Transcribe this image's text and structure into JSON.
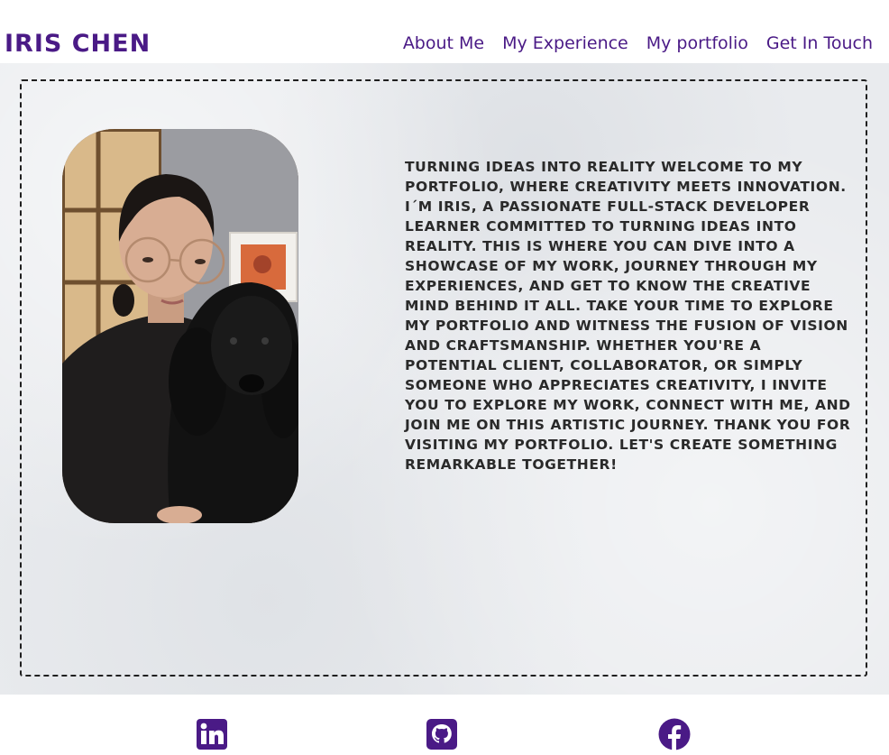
{
  "header": {
    "brand": "IRIS CHEN",
    "nav": [
      {
        "label": "About Me"
      },
      {
        "label": "My Experience"
      },
      {
        "label": "My portfolio"
      },
      {
        "label": "Get In Touch"
      }
    ]
  },
  "about": {
    "bio": "Turning ideas into reality Welcome to my portfolio, where creativity meets innovation. I´m Iris, a passionate full-stack developer learner committed to turning ideas into reality. This is where you can dive into a showcase of my work, journey through my experiences, and get to know the creative mind behind it all. Take your time to explore my portfolio and witness the fusion of vision and craftsmanship. Whether you're a potential client, collaborator, or simply someone who appreciates creativity, I invite you to explore my work, connect with me, and join me on this artistic journey. Thank you for visiting my portfolio. Let's create something remarkable together!"
  },
  "footer": {
    "icons": [
      "linkedin-icon",
      "github-icon",
      "facebook-icon"
    ]
  },
  "colors": {
    "brand": "#4a1a86",
    "text": "#2a2a2a",
    "frame": "#1f1f1f",
    "background": "#e9ebee"
  }
}
